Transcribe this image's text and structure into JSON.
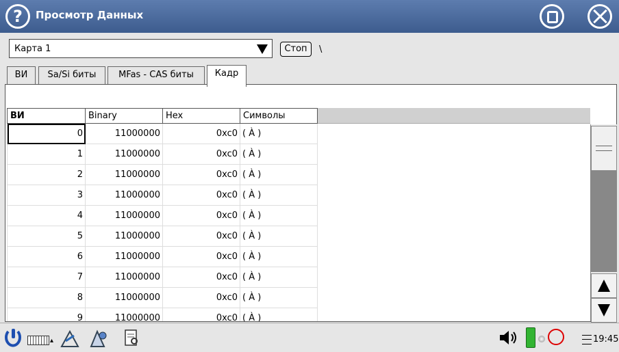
{
  "window": {
    "title": "Просмотр Данных"
  },
  "toolbar": {
    "card_value": "Карта 1",
    "stop_label": "Стоп",
    "path": "\\"
  },
  "tabs": [
    {
      "label": "ВИ",
      "active": false
    },
    {
      "label": "Sa/Si биты",
      "active": false
    },
    {
      "label": "MFas - CAS биты",
      "active": false
    },
    {
      "label": "Кадр",
      "active": true
    }
  ],
  "table": {
    "headers": [
      "ВИ",
      "Binary",
      "Hex",
      "Символы"
    ],
    "rows": [
      {
        "vi": "0",
        "binary": "11000000",
        "hex": "0xc0",
        "symbol": "( À )"
      },
      {
        "vi": "1",
        "binary": "11000000",
        "hex": "0xc0",
        "symbol": "( À )"
      },
      {
        "vi": "2",
        "binary": "11000000",
        "hex": "0xc0",
        "symbol": "( À )"
      },
      {
        "vi": "3",
        "binary": "11000000",
        "hex": "0xc0",
        "symbol": "( À )"
      },
      {
        "vi": "4",
        "binary": "11000000",
        "hex": "0xc0",
        "symbol": "( À )"
      },
      {
        "vi": "5",
        "binary": "11000000",
        "hex": "0xc0",
        "symbol": "( À )"
      },
      {
        "vi": "6",
        "binary": "11000000",
        "hex": "0xc0",
        "symbol": "( À )"
      },
      {
        "vi": "7",
        "binary": "11000000",
        "hex": "0xc0",
        "symbol": "( À )"
      },
      {
        "vi": "8",
        "binary": "11000000",
        "hex": "0xc0",
        "symbol": "( À )"
      },
      {
        "vi": "9",
        "binary": "11000000",
        "hex": "0xc0",
        "symbol": "( À )"
      }
    ]
  },
  "taskbar": {
    "clock": "19:45"
  },
  "colors": {
    "titlebar": "#4a6a9c",
    "battery": "#32b432",
    "record": "#dd0000"
  },
  "icons": [
    "help-icon",
    "maximize-icon",
    "close-icon",
    "dropdown-arrow-icon",
    "scroll-up-icon",
    "scroll-down-icon",
    "start-icon",
    "keyboard-icon",
    "speaker-icon",
    "battery-icon",
    "record-icon",
    "menu-icon"
  ]
}
